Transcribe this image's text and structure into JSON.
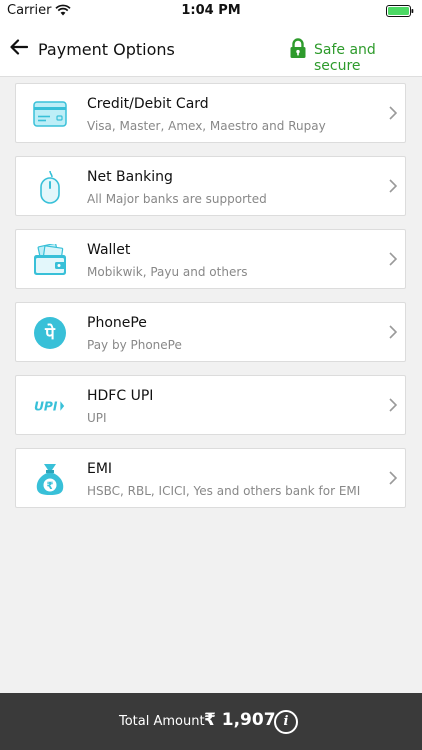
{
  "status_bar": {
    "carrier": "Carrier",
    "time": "1:04 PM"
  },
  "header": {
    "title": "Payment Options",
    "secure_label": "Safe and secure",
    "secure_color": "#2e9b2c"
  },
  "payment_options": [
    {
      "title": "Credit/Debit Card",
      "subtitle": "Visa, Master, Amex, Maestro and Rupay",
      "icon": "credit-card-icon"
    },
    {
      "title": "Net Banking",
      "subtitle": "All Major banks are supported",
      "icon": "mouse-icon"
    },
    {
      "title": "Wallet",
      "subtitle": "Mobikwik, Payu and others",
      "icon": "wallet-icon"
    },
    {
      "title": "PhonePe",
      "subtitle": "Pay by PhonePe",
      "icon": "phonepe-icon",
      "icon_text": "पे"
    },
    {
      "title": "HDFC UPI",
      "subtitle": "UPI",
      "icon": "upi-icon",
      "icon_text": "UPI"
    },
    {
      "title": "EMI",
      "subtitle": "HSBC, RBL, ICICI, Yes and others bank for EMI",
      "icon": "money-bag-icon",
      "icon_text": "₹"
    }
  ],
  "footer": {
    "total_label": "Total Amount",
    "amount": "₹ 1,907",
    "info_glyph": "i"
  },
  "colors": {
    "accent": "#38c0d8",
    "secure": "#2e9b2c",
    "footer_bg": "#3a3a3a"
  }
}
